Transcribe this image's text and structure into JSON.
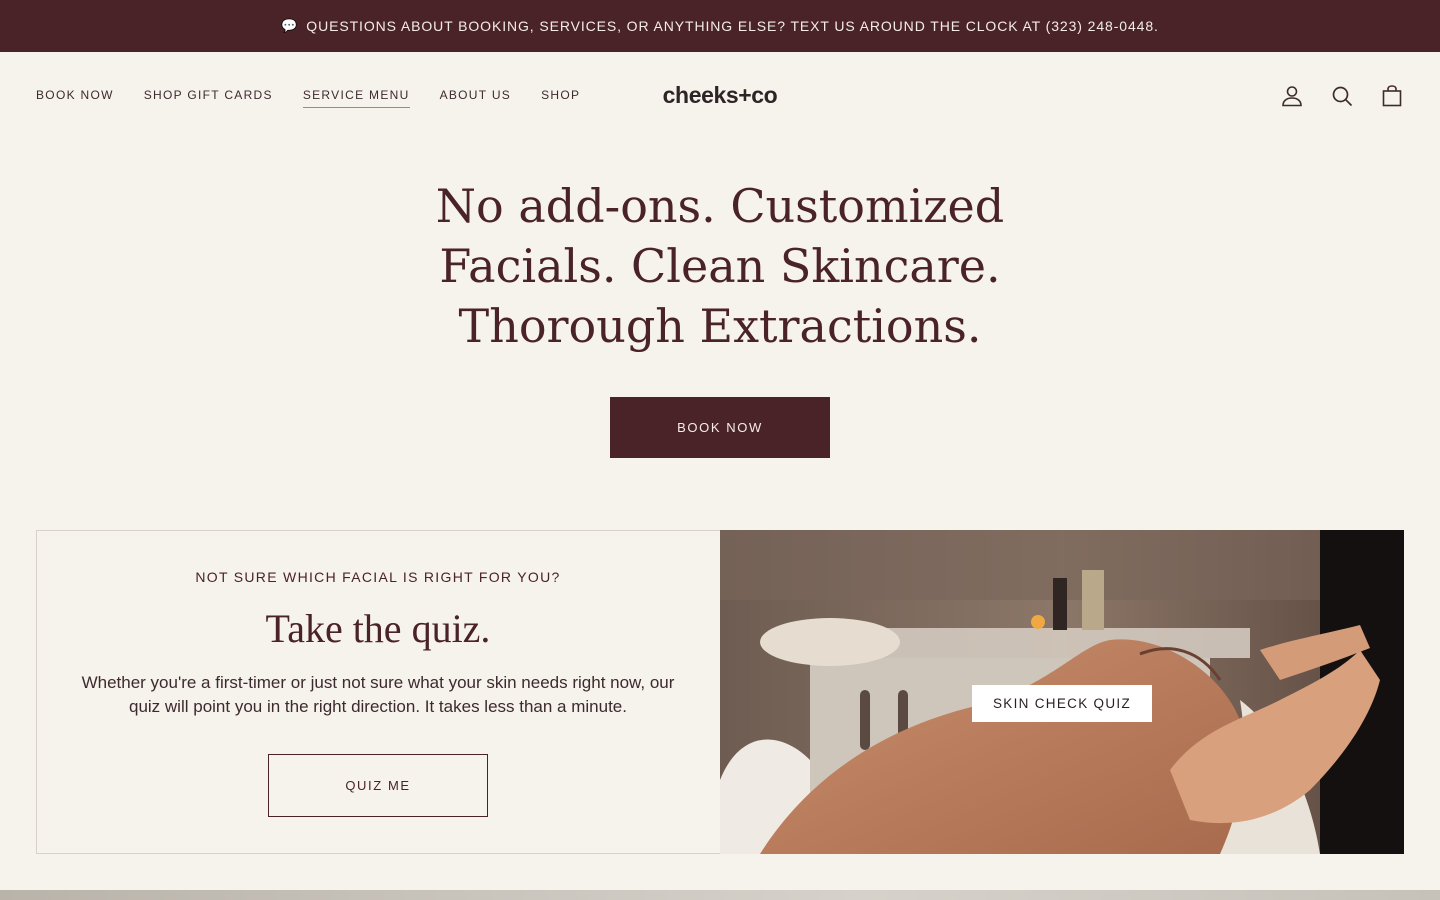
{
  "announcement": {
    "icon": "speech-bubble-icon",
    "text": "QUESTIONS ABOUT BOOKING, SERVICES, OR ANYTHING ELSE? TEXT US AROUND THE CLOCK AT (323) 248-0448."
  },
  "nav": {
    "items": [
      {
        "label": "BOOK NOW",
        "active": false
      },
      {
        "label": "SHOP GIFT CARDS",
        "active": false
      },
      {
        "label": "SERVICE MENU",
        "active": true
      },
      {
        "label": "ABOUT US",
        "active": false
      },
      {
        "label": "SHOP",
        "active": false
      }
    ]
  },
  "brand": {
    "logo": "cheeks+co"
  },
  "header_icons": [
    "account-icon",
    "search-icon",
    "cart-icon"
  ],
  "hero": {
    "title_lines": [
      "No add-ons. Customized",
      "Facials. Clean Skincare.",
      "Thorough Extractions."
    ],
    "cta_label": "BOOK NOW"
  },
  "quiz": {
    "eyebrow": "NOT SURE WHICH FACIAL IS RIGHT FOR YOU?",
    "title": "Take the quiz.",
    "description": "Whether you're a first-timer or just not sure what your skin needs right now, our quiz will point you in the right direction. It takes less than a minute.",
    "button_label": "QUIZ ME",
    "image_tag_label": "SKIN CHECK QUIZ"
  },
  "colors": {
    "brand": "#4a2329",
    "background": "#f6f2ec",
    "text": "#4a2229"
  }
}
